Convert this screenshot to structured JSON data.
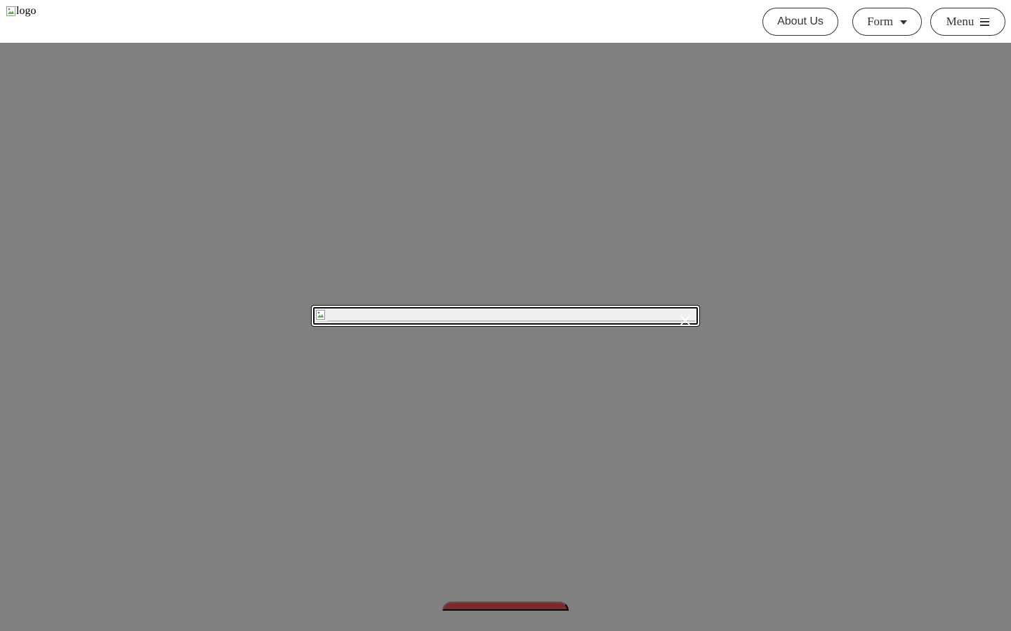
{
  "header": {
    "logo_alt": "logo",
    "nav": {
      "about_label": "About Us",
      "form_label": "Form",
      "menu_label": "Menu"
    }
  },
  "icons": {
    "logo": "broken-image-icon",
    "form_dropdown": "caret-down-icon",
    "menu": "hamburger-icon",
    "modal_image": "broken-image-icon",
    "modal_close": "close-icon"
  },
  "modal": {
    "image_alt": ""
  },
  "cta": {
    "label": ""
  },
  "colors": {
    "overlay": "#808080",
    "pill_border": "#333333",
    "cta_background": "#7f2a2a",
    "modal_border": "#111111"
  }
}
